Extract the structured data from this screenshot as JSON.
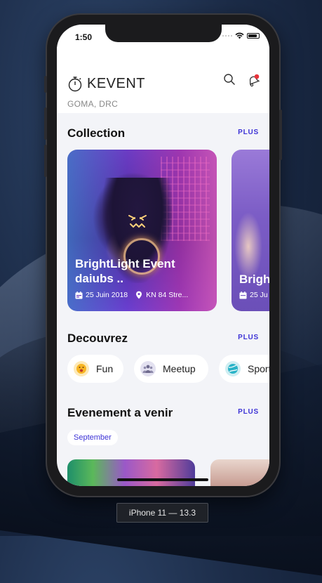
{
  "status_bar": {
    "time": "1:50"
  },
  "app": {
    "name": "KEVENT",
    "location": "GOMA, DRC"
  },
  "icons": {
    "logo": "stopwatch-icon",
    "search": "search-icon",
    "notifications": "bell-icon",
    "date": "calendar-icon",
    "place": "location-pin-icon"
  },
  "colors": {
    "accent": "#3d33d6",
    "notification_dot": "#e8333b",
    "background": "#f3f4f8"
  },
  "collection": {
    "title": "Collection",
    "more": "PLUS",
    "cards": [
      {
        "title_line1": "BrightLight Event",
        "title_line2": "daiubs ..",
        "date": "25 Juin 2018",
        "place": "KN 84 Stre..."
      },
      {
        "title_line1": "Brigh",
        "date": "25 Ju"
      }
    ]
  },
  "discover": {
    "title": "Decouvrez",
    "more": "PLUS",
    "categories": [
      {
        "label": "Fun",
        "icon": "smiley-icon"
      },
      {
        "label": "Meetup",
        "icon": "people-icon"
      },
      {
        "label": "Sport",
        "icon": "ball-icon"
      }
    ]
  },
  "upcoming": {
    "title": "Evenement a venir",
    "more": "PLUS",
    "month": "September"
  },
  "device": {
    "label": "iPhone 11 — 13.3"
  }
}
